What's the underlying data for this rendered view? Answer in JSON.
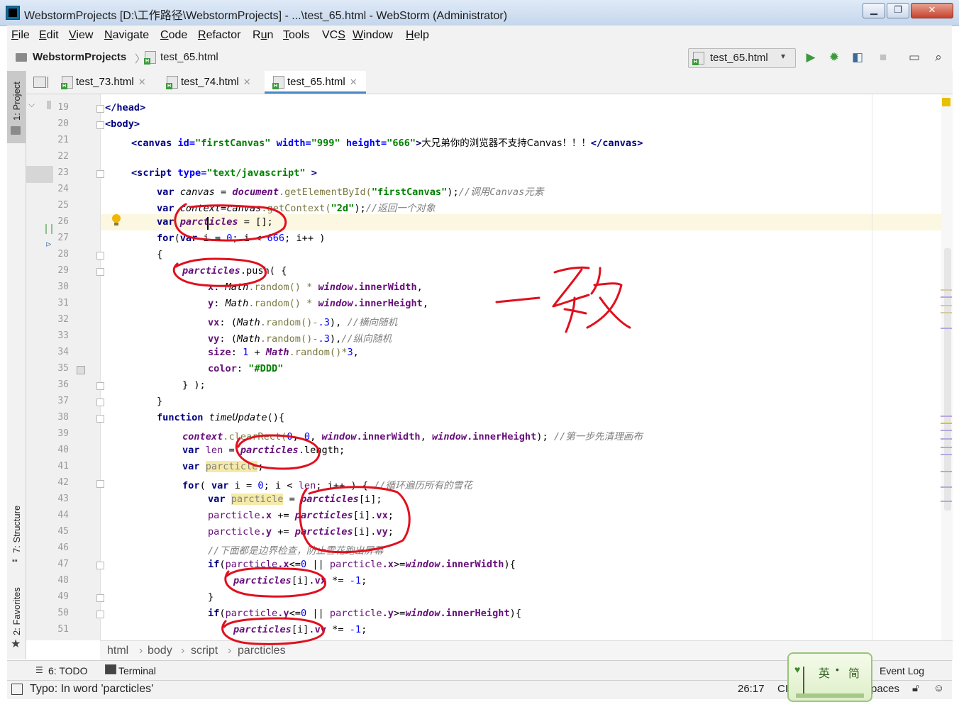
{
  "window": {
    "title": "WebstormProjects [D:\\工作路径\\WebstormProjects] - ...\\test_65.html - WebStorm (Administrator)",
    "controls": [
      "▁",
      "❐",
      "✕"
    ]
  },
  "menu": [
    "File",
    "Edit",
    "View",
    "Navigate",
    "Code",
    "Refactor",
    "Run",
    "Tools",
    "VCS",
    "Window",
    "Help"
  ],
  "menu_mnemonics": [
    "F",
    "E",
    "V",
    "N",
    "C",
    "R",
    "u",
    "T",
    "S",
    "W",
    "H"
  ],
  "nav": {
    "project": "WebstormProjects",
    "file": "test_65.html",
    "run_config": "test_65.html"
  },
  "left_strip": {
    "project": "1: Project",
    "structure": "7: Structure",
    "favorites": "2: Favorites"
  },
  "tabs": [
    {
      "label": "test_73.html"
    },
    {
      "label": "test_74.html"
    },
    {
      "label": "test_65.html",
      "active": true
    }
  ],
  "tab_close": "✕",
  "line_numbers": [
    "19",
    "20",
    "21",
    "22",
    "23",
    "24",
    "25",
    "26",
    "27",
    "28",
    "29",
    "30",
    "31",
    "32",
    "33",
    "34",
    "35",
    "36",
    "37",
    "38",
    "39",
    "40",
    "41",
    "42",
    "43",
    "44",
    "45",
    "46",
    "47",
    "48",
    "49",
    "50",
    "51"
  ],
  "code": {
    "l19_tag": "</head>",
    "l20_tag": "<body>",
    "l21_open": "<canvas",
    "l21_a1": " id=",
    "l21_v1": "\"firstCanvas\"",
    "l21_a2": " width=",
    "l21_v2": "\"999\"",
    "l21_a3": " height=",
    "l21_v3": "\"666\"",
    "l21_gt": ">",
    "l21_text": "大兄弟你的浏览器不支持Canvas！！！",
    "l21_close": "</canvas>",
    "l23_open": "<script",
    "l23_a1": " type=",
    "l23_v1": "\"text/javascript\"",
    "l23_gt": " >",
    "l24": {
      "kw": "var ",
      "name": "canvas",
      "op": " = ",
      "obj": "document",
      "call": ".getElementById(",
      "arg": "\"firstCanvas\"",
      "end": ");",
      "cmt": "//调用Canvas元素"
    },
    "l25": {
      "kw": "var ",
      "name": "context",
      "op": "=",
      "obj": "canvas",
      "call": ".getContext(",
      "arg": "\"2d\"",
      "end": ");",
      "cmt": "//返回一个对象"
    },
    "l26": {
      "kw": "var ",
      "name": "parcticles",
      "rest": " = [];"
    },
    "l27": {
      "kw": "for",
      "a": "(",
      "kw2": "var",
      "b": " i = ",
      "n1": "0",
      "c": "; i < ",
      "n2": "666",
      "d": "; i++ )"
    },
    "l28": "{",
    "l29": {
      "name": "parcticles",
      "rest": ".push( {"
    },
    "l30": {
      "key": "x",
      "c": ": ",
      "obj": "Math",
      "m": ".random() * ",
      "obj2": "window",
      "f": ".innerWidth",
      "end": ","
    },
    "l31": {
      "key": "y",
      "c": ": ",
      "obj": "Math",
      "m": ".random() * ",
      "obj2": "window",
      "f": ".innerHeight",
      "end": ","
    },
    "l32": {
      "key": "vx",
      "c": ": (",
      "obj": "Math",
      "m": ".random()-",
      "n": ".3",
      "end": "), ",
      "cmt": "//横向随机"
    },
    "l33": {
      "key": "vy",
      "c": ": (",
      "obj": "Math",
      "m": ".random()-",
      "n": ".3",
      "end": "),",
      "cmt": "//纵向随机"
    },
    "l34": {
      "key": "size",
      "c": ": ",
      "n": "1",
      "p": " + ",
      "obj": "Math",
      "m": ".random()*",
      "n2": "3",
      "end": ","
    },
    "l35": {
      "key": "color",
      "c": ": ",
      "str": "\"#DDD\""
    },
    "l36": "} );",
    "l37": "}",
    "l38": {
      "kw": "function ",
      "name": "timeUpdate",
      "rest": "(){"
    },
    "l39": {
      "obj": "context",
      "m": ".clearRect(",
      "n1": "0",
      "s": ", ",
      "n2": "0",
      "s2": ", ",
      "w": "window",
      "f1": ".innerWidth",
      "s3": ", ",
      "w2": "window",
      "f2": ".innerHeight",
      "end": "); ",
      "cmt": "//第一步先清理画布"
    },
    "l40": {
      "kw": "var ",
      "name": "len",
      "op": " = ",
      "obj": "parcticles",
      "f": ".length",
      "end": ";"
    },
    "l41": {
      "kw": "var ",
      "name": "parcticle",
      "end": ";"
    },
    "l42": {
      "kw": "for",
      "a": "( ",
      "kw2": "var",
      "b": " i = ",
      "n1": "0",
      "c": "; i < ",
      "len": "len",
      "d": "; i++ ) { ",
      "cmt": "//循环遍历所有的雪花"
    },
    "l43": {
      "kw": "var ",
      "name": "parcticle",
      "op": " = ",
      "obj": "parcticles",
      "end": "[i];"
    },
    "l44": {
      "a": "parcticle",
      "f": ".x",
      "op": " += ",
      "obj": "parcticles",
      "end": "[i].",
      "f2": "vx",
      "s": ";"
    },
    "l45": {
      "a": "parcticle",
      "f": ".y",
      "op": " += ",
      "obj": "parcticles",
      "end": "[i].",
      "f2": "vy",
      "s": ";"
    },
    "l46": {
      "cmt": "//下面都是边界检查，防止雪花跑出屏幕"
    },
    "l47": {
      "kw": "if",
      "a": "(",
      "b": "parcticle",
      "f": ".x",
      "c": "<=",
      "n": "0",
      "d": " || ",
      "e": "parcticle",
      "f2": ".x",
      "g": ">=",
      "w": "window",
      "f3": ".innerWidth",
      "end": "){"
    },
    "l48": {
      "obj": "parcticles",
      "end": "[i].",
      "f": "vx",
      "op": " *= ",
      "n": "-1",
      "s": ";"
    },
    "l49": "}",
    "l50": {
      "kw": "if",
      "a": "(",
      "b": "parcticle",
      "f": ".y",
      "c": "<=",
      "n": "0",
      "d": " || ",
      "e": "parcticle",
      "f2": ".y",
      "g": ">=",
      "w": "window",
      "f3": ".innerHeight",
      "end": "){"
    },
    "l51": {
      "obj": "parcticles",
      "end": "[i].",
      "f": "vy",
      "op": " *= ",
      "n": "-1",
      "s": ";"
    }
  },
  "handwriting": "一致",
  "breadcrumb": [
    "html",
    "body",
    "script",
    "parcticles"
  ],
  "breadcrumb_sep": "›",
  "bottom_tools": {
    "todo": "6: TODO",
    "terminal": "Terminal",
    "event_log": "Event Log"
  },
  "status": {
    "message": "Typo: In word 'parcticles'",
    "position": "26:17",
    "encoding_partial": "CI",
    "spaces_partial": "paces"
  },
  "ime": {
    "lang": "英",
    "dot": "•",
    "mode": "简"
  },
  "colors": {
    "accent": "#4a88c7",
    "run_green": "#3b9a3b",
    "ink_red": "#e0101e",
    "warning": "#e8c000"
  }
}
